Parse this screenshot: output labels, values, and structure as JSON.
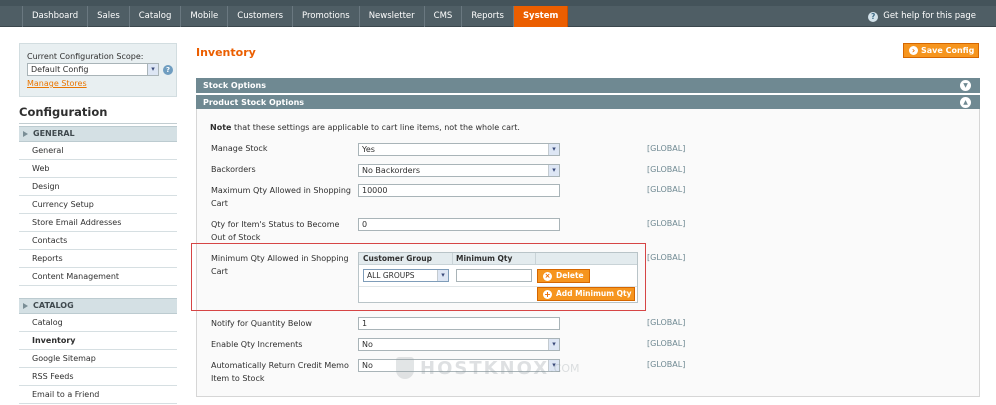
{
  "nav": {
    "items": [
      "Dashboard",
      "Sales",
      "Catalog",
      "Mobile",
      "Customers",
      "Promotions",
      "Newsletter",
      "CMS",
      "Reports",
      "System"
    ],
    "active": "System",
    "help": "Get help for this page"
  },
  "sidebar": {
    "scope_label": "Current Configuration Scope:",
    "scope_value": "Default Config",
    "manage_stores": "Manage Stores",
    "title": "Configuration",
    "general_header": "GENERAL",
    "general_items": [
      "General",
      "Web",
      "Design",
      "Currency Setup",
      "Store Email Addresses",
      "Contacts",
      "Reports",
      "Content Management"
    ],
    "catalog_header": "CATALOG",
    "catalog_items": [
      "Catalog",
      "Inventory",
      "Google Sitemap",
      "RSS Feeds",
      "Email to a Friend"
    ],
    "selected": "Inventory"
  },
  "main": {
    "title": "Inventory",
    "save_button": "Save Config",
    "groups": [
      "Stock Options",
      "Product Stock Options"
    ],
    "note_bold": "Note",
    "note_text": " that these settings are applicable to cart line items, not the whole cart.",
    "fields": [
      {
        "label": "Manage Stock",
        "value": "Yes",
        "scope": "[GLOBAL]"
      },
      {
        "label": "Backorders",
        "value": "No Backorders",
        "scope": "[GLOBAL]"
      },
      {
        "label": "Maximum Qty Allowed in Shopping Cart",
        "value": "10000",
        "scope": "[GLOBAL]"
      },
      {
        "label": "Qty for Item's Status to Become Out of Stock",
        "value": "0",
        "scope": "[GLOBAL]"
      },
      {
        "label": "Minimum Qty Allowed in Shopping Cart",
        "value": "",
        "scope": "[GLOBAL]"
      },
      {
        "label": "Notify for Quantity Below",
        "value": "1",
        "scope": "[GLOBAL]"
      },
      {
        "label": "Enable Qty Increments",
        "value": "No",
        "scope": "[GLOBAL]"
      },
      {
        "label": "Automatically Return Credit Memo Item to Stock",
        "value": "No",
        "scope": "[GLOBAL]"
      }
    ],
    "min_qty_table": {
      "col_group": "Customer Group",
      "col_qty": "Minimum Qty",
      "group_value": "ALL GROUPS",
      "qty_value": "",
      "delete_button": "Delete",
      "add_button": "Add Minimum Qty"
    }
  },
  "watermark": {
    "text": "HOSTKNOX",
    "suffix": ".COM"
  }
}
